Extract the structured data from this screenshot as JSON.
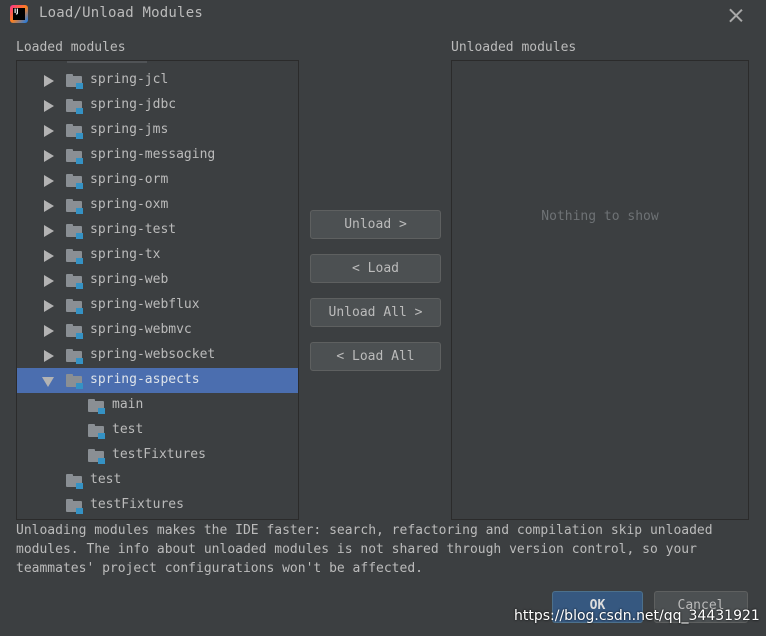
{
  "window": {
    "title": "Load/Unload Modules",
    "logo_text": "IJ"
  },
  "loaded": {
    "label": "Loaded modules",
    "items": [
      {
        "label": "spring-jcl",
        "expanded": false
      },
      {
        "label": "spring-jdbc",
        "expanded": false
      },
      {
        "label": "spring-jms",
        "expanded": false
      },
      {
        "label": "spring-messaging",
        "expanded": false
      },
      {
        "label": "spring-orm",
        "expanded": false
      },
      {
        "label": "spring-oxm",
        "expanded": false
      },
      {
        "label": "spring-test",
        "expanded": false
      },
      {
        "label": "spring-tx",
        "expanded": false
      },
      {
        "label": "spring-web",
        "expanded": false
      },
      {
        "label": "spring-webflux",
        "expanded": false
      },
      {
        "label": "spring-webmvc",
        "expanded": false
      },
      {
        "label": "spring-websocket",
        "expanded": false
      },
      {
        "label": "spring-aspects",
        "expanded": true,
        "selected": true
      },
      {
        "label": "main",
        "child": true
      },
      {
        "label": "test",
        "child": true
      },
      {
        "label": "testFixtures",
        "child": true
      },
      {
        "label": "test"
      },
      {
        "label": "testFixtures"
      }
    ]
  },
  "actions": {
    "unload": "Unload >",
    "load": "< Load",
    "unload_all": "Unload All >",
    "load_all": "< Load All"
  },
  "unloaded": {
    "label": "Unloaded modules",
    "empty_text": "Nothing to show"
  },
  "info": "Unloading modules makes the IDE faster: search, refactoring and compilation skip unloaded modules. The info about unloaded modules is not shared through version control, so your teammates' project configurations won't be affected.",
  "footer": {
    "ok": "OK",
    "cancel": "Cancel"
  },
  "watermark": "https://blog.csdn.net/qq_34431921",
  "colors": {
    "background": "#3c3f41",
    "selection": "#4b6eaf",
    "module_badge": "#3592c4",
    "ok_button": "#365880"
  }
}
